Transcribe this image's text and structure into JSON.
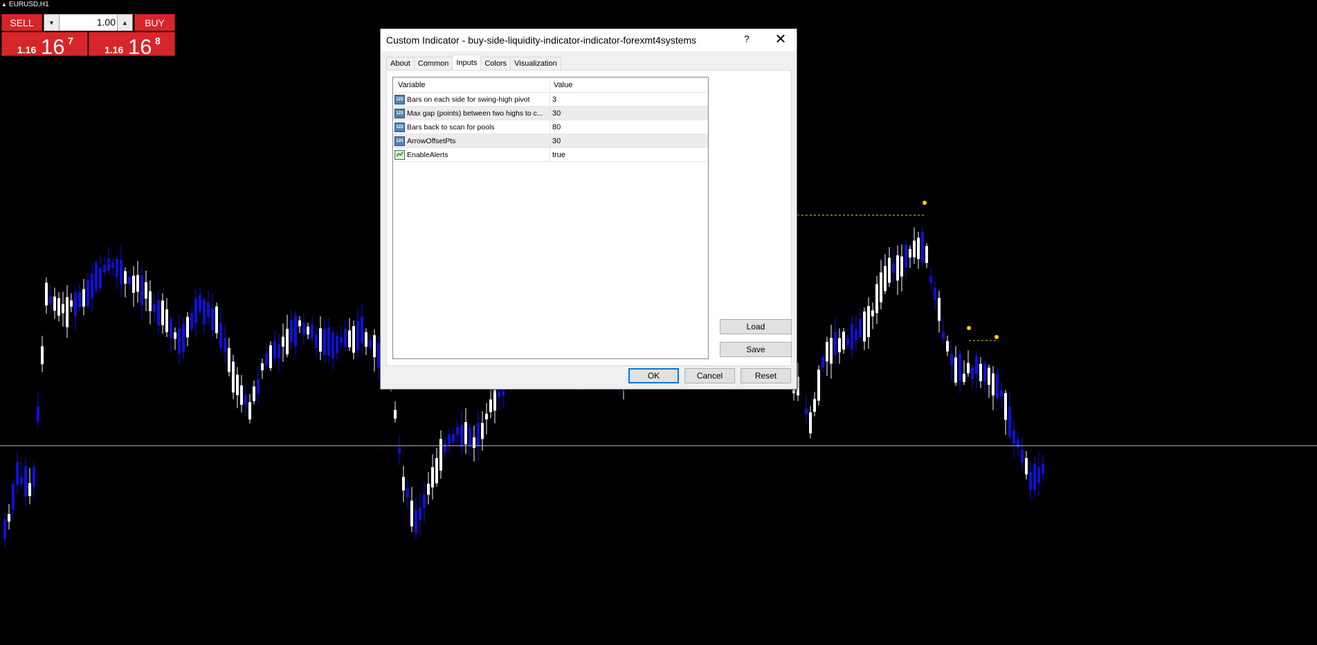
{
  "chart": {
    "symbol_label": "EURUSD,H1",
    "bull_color": "#ffffff",
    "bear_color": "#1010d8",
    "marker_color": "#ffd400",
    "crosshair_color": "#c8c8c8",
    "background": "#000000"
  },
  "trade_panel": {
    "sell_label": "SELL",
    "buy_label": "BUY",
    "lot_value": "1.00",
    "sell_price": {
      "big": "1.16",
      "pips": "16",
      "frac": "7"
    },
    "buy_price": {
      "big": "1.16",
      "pips": "16",
      "frac": "8"
    }
  },
  "dialog": {
    "title": "Custom Indicator - buy-side-liquidity-indicator-indicator-forexmt4systems",
    "help_label": "?",
    "close_label": "✕",
    "tabs": [
      {
        "label": "About"
      },
      {
        "label": "Common"
      },
      {
        "label": "Inputs",
        "active": true
      },
      {
        "label": "Colors"
      },
      {
        "label": "Visualization"
      }
    ],
    "grid": {
      "col_variable": "Variable",
      "col_value": "Value",
      "rows": [
        {
          "icon": "integer-icon",
          "icon_text": "123",
          "variable": "Bars on each side for swing-high pivot",
          "value": "3"
        },
        {
          "icon": "integer-icon",
          "icon_text": "123",
          "variable": "Max gap (points) between two highs to c...",
          "value": "30"
        },
        {
          "icon": "integer-icon",
          "icon_text": "123",
          "variable": "Bars back to scan for pools",
          "value": "80"
        },
        {
          "icon": "integer-icon",
          "icon_text": "123",
          "variable": "ArrowOffsetPts",
          "value": "30"
        },
        {
          "icon": "boolean-icon",
          "icon_text": "",
          "variable": "EnableAlerts",
          "value": "true"
        }
      ]
    },
    "buttons": {
      "load": "Load",
      "save": "Save",
      "ok": "OK",
      "cancel": "Cancel",
      "reset": "Reset"
    }
  }
}
